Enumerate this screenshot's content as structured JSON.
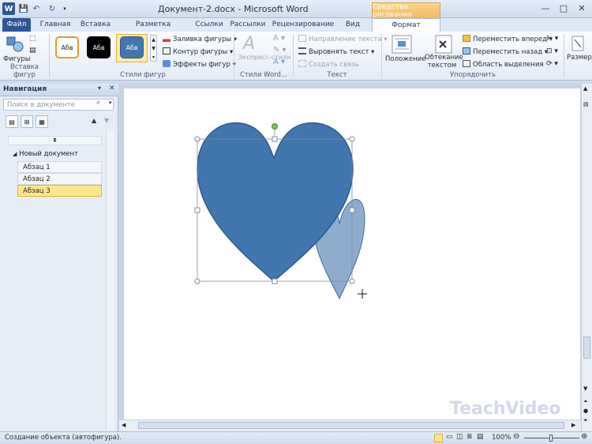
{
  "window": {
    "title": "Документ-2.docx  -  Microsoft Word",
    "controls": [
      "—",
      "□",
      "✕"
    ]
  },
  "quick_access": {
    "app_icon": "W",
    "save": "💾",
    "undo": "↶",
    "redo": "↻"
  },
  "context_tab": {
    "label": "Средства рисования"
  },
  "tabs": [
    {
      "label": "Файл"
    },
    {
      "label": "Главная"
    },
    {
      "label": "Вставка"
    },
    {
      "label": "Разметка страницы"
    },
    {
      "label": "Ссылки"
    },
    {
      "label": "Рассылки"
    },
    {
      "label": "Рецензирование"
    },
    {
      "label": "Вид"
    },
    {
      "label": "Формат"
    }
  ],
  "ribbon": {
    "insert_shapes": {
      "shapes_label": "Фигуры",
      "group_label": "Вставка фигур"
    },
    "shape_styles": {
      "thumbs": [
        "Абв",
        "Абв",
        "Абв"
      ],
      "fill": "Заливка фигуры",
      "outline": "Контур фигуры",
      "effects": "Эффекты фигур",
      "group_label": "Стили фигур"
    },
    "wordart": {
      "quick_styles": "Экспресс-стили",
      "group_label": "Стили Word..."
    },
    "text": {
      "direction": "Направление текста",
      "align": "Выровнять текст",
      "link": "Создать связь",
      "group_label": "Текст"
    },
    "arrange": {
      "position": "Положение",
      "wrap_line1": "Обтекание",
      "wrap_line2": "текстом",
      "bring_forward": "Переместить вперед",
      "send_backward": "Переместить назад",
      "selection_pane": "Область выделения",
      "group_label": "Упорядочить"
    },
    "size": {
      "label": "Размер"
    }
  },
  "navigation": {
    "title": "Навигация",
    "search_placeholder": "Поиск в документе",
    "items": [
      {
        "label": "Новый документ"
      },
      {
        "label": "Абзац 1"
      },
      {
        "label": "Абзац 2"
      },
      {
        "label": "Абзац 3"
      }
    ]
  },
  "status": {
    "text": "Создание объекта (автофигура).",
    "zoom": "100%"
  },
  "colors": {
    "heart_fill": "#4276ae",
    "heart_stroke": "#2f5a8a",
    "selection_handle": "#7a8ca6",
    "rotation_handle": "#7fc160",
    "ghost_heart": "rgba(66,118,174,0.6)"
  },
  "watermark": "TeachVideo"
}
